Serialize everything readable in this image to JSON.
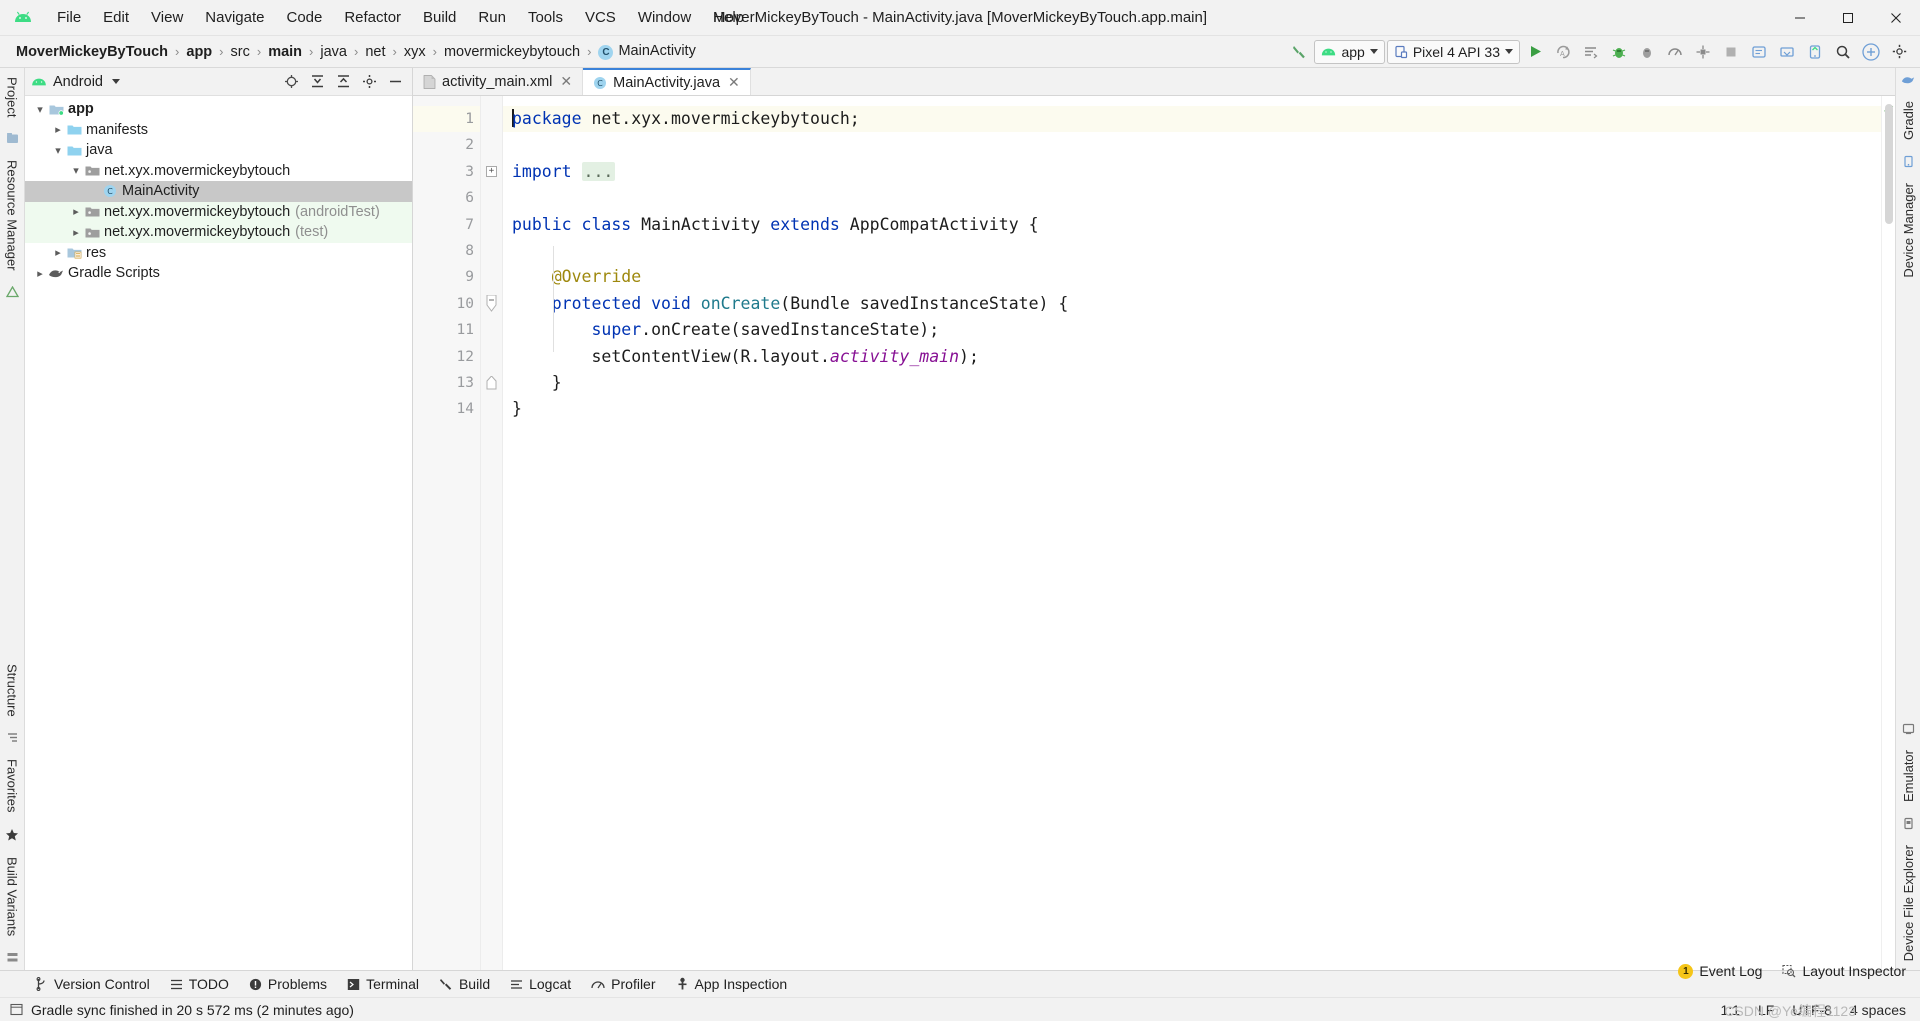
{
  "window": {
    "title": "MoverMickeyByTouch - MainActivity.java [MoverMickeyByTouch.app.main]",
    "minimize_label": "–",
    "maximize_label": "❐",
    "close_label": "✕"
  },
  "menubar": {
    "items": [
      {
        "label": "File"
      },
      {
        "label": "Edit"
      },
      {
        "label": "View"
      },
      {
        "label": "Navigate"
      },
      {
        "label": "Code"
      },
      {
        "label": "Refactor"
      },
      {
        "label": "Build"
      },
      {
        "label": "Run"
      },
      {
        "label": "Tools"
      },
      {
        "label": "VCS"
      },
      {
        "label": "Window"
      },
      {
        "label": "Help"
      }
    ]
  },
  "breadcrumb": {
    "items": [
      {
        "label": "MoverMickeyByTouch",
        "bold": true
      },
      {
        "label": "app",
        "bold": true
      },
      {
        "label": "src",
        "bold": false
      },
      {
        "label": "main",
        "bold": true
      },
      {
        "label": "java",
        "bold": false
      },
      {
        "label": "net",
        "bold": false
      },
      {
        "label": "xyx",
        "bold": false
      },
      {
        "label": "movermickeybytouch",
        "bold": false
      },
      {
        "label": "MainActivity",
        "bold": false,
        "icon": "class-icon"
      }
    ],
    "separator": "›"
  },
  "toolbar": {
    "build_label": "Build",
    "run_config": "app",
    "device": "Pixel 4 API 33",
    "run_label": "Run",
    "apply_changes_label": "Apply Changes",
    "apply_code_changes_label": "Apply Code Changes",
    "debug_label": "Debug",
    "attach_debugger_label": "Attach Debugger",
    "profiler_label": "Profile",
    "device_manager_label": "Device Manager",
    "stop_label": "Stop",
    "logcat_label": "Logcat",
    "sdk_manager_label": "SDK Manager",
    "avd_manager_label": "AVD Manager",
    "search_label": "Search Everywhere",
    "account_label": "Account",
    "settings_label": "Settings"
  },
  "project_panel": {
    "title": "Android",
    "actions": [
      {
        "name": "select-opened-file-icon",
        "label": "Select Opened File"
      },
      {
        "name": "expand-all-icon",
        "label": "Expand All"
      },
      {
        "name": "collapse-all-icon",
        "label": "Collapse All"
      },
      {
        "name": "settings-gear-icon",
        "label": "Settings"
      },
      {
        "name": "hide-icon",
        "label": "Hide"
      }
    ],
    "tree": [
      {
        "label": "app",
        "suffix": "",
        "depth": 0,
        "arrow": "down",
        "icon": "module-folder-icon",
        "bold": true,
        "selected": false,
        "test": false
      },
      {
        "label": "manifests",
        "suffix": "",
        "depth": 1,
        "arrow": "right",
        "icon": "folder-icon",
        "bold": false,
        "selected": false,
        "test": false
      },
      {
        "label": "java",
        "suffix": "",
        "depth": 1,
        "arrow": "down",
        "icon": "folder-icon",
        "bold": false,
        "selected": false,
        "test": false
      },
      {
        "label": "net.xyx.movermickeybytouch",
        "suffix": "",
        "depth": 2,
        "arrow": "down",
        "icon": "package-icon",
        "bold": false,
        "selected": false,
        "test": false
      },
      {
        "label": "MainActivity",
        "suffix": "",
        "depth": 3,
        "arrow": "none",
        "icon": "class-icon",
        "bold": false,
        "selected": true,
        "test": false
      },
      {
        "label": "net.xyx.movermickeybytouch",
        "suffix": "(androidTest)",
        "depth": 2,
        "arrow": "right",
        "icon": "package-icon",
        "bold": false,
        "selected": false,
        "test": true
      },
      {
        "label": "net.xyx.movermickeybytouch",
        "suffix": "(test)",
        "depth": 2,
        "arrow": "right",
        "icon": "package-icon",
        "bold": false,
        "selected": false,
        "test": true
      },
      {
        "label": "res",
        "suffix": "",
        "depth": 1,
        "arrow": "right",
        "icon": "res-folder-icon",
        "bold": false,
        "selected": false,
        "test": false
      },
      {
        "label": "Gradle Scripts",
        "suffix": "",
        "depth": 0,
        "arrow": "right",
        "icon": "gradle-icon",
        "bold": false,
        "selected": false,
        "test": false
      }
    ]
  },
  "left_rail": {
    "top": [
      {
        "label": "Project"
      }
    ],
    "mid": [
      {
        "label": "Resource Manager"
      }
    ],
    "bottom": [
      {
        "label": "Structure"
      },
      {
        "label": "Favorites"
      },
      {
        "label": "Build Variants"
      }
    ]
  },
  "right_rail": {
    "items": [
      {
        "label": "Gradle"
      },
      {
        "label": "Device Manager"
      },
      {
        "label": "Emulator"
      },
      {
        "label": "Device File Explorer"
      }
    ]
  },
  "editor": {
    "tabs": [
      {
        "label": "activity_main.xml",
        "icon": "xml-file-icon",
        "active": false,
        "close": "✕"
      },
      {
        "label": "MainActivity.java",
        "icon": "class-icon",
        "active": true,
        "close": "✕"
      }
    ],
    "line_numbers": [
      "1",
      "2",
      "3",
      "6",
      "7",
      "8",
      "9",
      "10",
      "11",
      "12",
      "13",
      "14"
    ],
    "lines": [
      {
        "n": "1",
        "highlight": true,
        "tokens": [
          {
            "t": "caret",
            "s": ""
          },
          {
            "t": "kw",
            "s": "package"
          },
          {
            "t": "plain",
            "s": " net.xyx.movermickeybytouch;"
          }
        ]
      },
      {
        "n": "2",
        "highlight": false,
        "tokens": []
      },
      {
        "n": "3",
        "highlight": false,
        "fold": "collapsed",
        "tokens": [
          {
            "t": "kw",
            "s": "import"
          },
          {
            "t": "plain",
            "s": " "
          },
          {
            "t": "fold",
            "s": "..."
          }
        ]
      },
      {
        "n": "6",
        "highlight": false,
        "tokens": []
      },
      {
        "n": "7",
        "highlight": false,
        "gutter_icon": "layout-preview-icon",
        "tokens": [
          {
            "t": "kw",
            "s": "public"
          },
          {
            "t": "plain",
            "s": " "
          },
          {
            "t": "kw",
            "s": "class"
          },
          {
            "t": "plain",
            "s": " MainActivity "
          },
          {
            "t": "kw",
            "s": "extends"
          },
          {
            "t": "plain",
            "s": " AppCompatActivity {"
          }
        ]
      },
      {
        "n": "8",
        "highlight": false,
        "tokens": []
      },
      {
        "n": "9",
        "highlight": false,
        "tokens": [
          {
            "t": "plain",
            "s": "    "
          },
          {
            "t": "anno",
            "s": "@Override"
          }
        ]
      },
      {
        "n": "10",
        "highlight": false,
        "gutter_icon": "override-method-icon",
        "fold": "open",
        "tokens": [
          {
            "t": "plain",
            "s": "    "
          },
          {
            "t": "kw",
            "s": "protected"
          },
          {
            "t": "plain",
            "s": " "
          },
          {
            "t": "kw",
            "s": "void"
          },
          {
            "t": "plain",
            "s": " "
          },
          {
            "t": "fn",
            "s": "onCreate"
          },
          {
            "t": "plain",
            "s": "(Bundle savedInstanceState) {"
          }
        ]
      },
      {
        "n": "11",
        "highlight": false,
        "tokens": [
          {
            "t": "plain",
            "s": "        "
          },
          {
            "t": "kw",
            "s": "super"
          },
          {
            "t": "plain",
            "s": ".onCreate(savedInstanceState);"
          }
        ]
      },
      {
        "n": "12",
        "highlight": false,
        "tokens": [
          {
            "t": "plain",
            "s": "        setContentView(R.layout."
          },
          {
            "t": "fld",
            "s": "activity_main"
          },
          {
            "t": "plain",
            "s": ");"
          }
        ]
      },
      {
        "n": "13",
        "highlight": false,
        "fold": "close",
        "tokens": [
          {
            "t": "plain",
            "s": "    }"
          }
        ]
      },
      {
        "n": "14",
        "highlight": false,
        "tokens": [
          {
            "t": "plain",
            "s": "}"
          }
        ]
      }
    ],
    "inspection_status": "✔"
  },
  "bottom_tabs": [
    {
      "label": "Version Control",
      "icon": "branch-icon"
    },
    {
      "label": "TODO",
      "icon": "list-icon"
    },
    {
      "label": "Problems",
      "icon": "problems-icon"
    },
    {
      "label": "Terminal",
      "icon": "terminal-icon"
    },
    {
      "label": "Build",
      "icon": "hammer-icon"
    },
    {
      "label": "Logcat",
      "icon": "logcat-icon"
    },
    {
      "label": "Profiler",
      "icon": "profiler-icon"
    },
    {
      "label": "App Inspection",
      "icon": "inspection-icon"
    }
  ],
  "status_bar": {
    "message": "Gradle sync finished in 20 s 572 ms (2 minutes ago)",
    "event_log_label": "Event Log",
    "event_log_count": "1",
    "layout_inspector_label": "Layout Inspector",
    "caret_position": "1:1",
    "line_separator": "LF",
    "encoding": "UTF-8",
    "indent": "4 spaces",
    "watermark": "CSDN @Ye编程1123"
  },
  "colors": {
    "accent_blue": "#3b82d9",
    "android_green": "#3ddc84",
    "keyword_blue": "#0033b3",
    "field_purple": "#871094",
    "annotation_gold": "#9e880d",
    "method_teal": "#1f7a8c",
    "test_source_bg": "#effaef",
    "selection_gray": "#c8c8c8"
  }
}
